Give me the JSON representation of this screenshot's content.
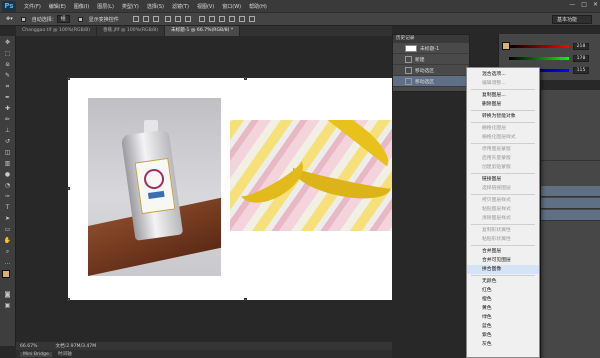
{
  "app": {
    "logo": "Ps"
  },
  "menubar": {
    "items": [
      "文件(F)",
      "编辑(E)",
      "图像(I)",
      "图层(L)",
      "类型(Y)",
      "选择(S)",
      "滤镜(T)",
      "视图(V)",
      "窗口(W)",
      "帮助(H)"
    ],
    "window_controls": [
      "—",
      "□",
      "✕"
    ]
  },
  "options": {
    "auto_select_label": "自动选择：",
    "auto_select_value": "组",
    "show_transform_label": "显示变换控件",
    "workspace": "基本功能"
  },
  "tabs": [
    {
      "label": "Changgao.tif @ 100%(RGB/8)",
      "active": false
    },
    {
      "label": "香蕉.jfif @ 100%(RGB/8)",
      "active": false
    },
    {
      "label": "未标题-1 @ 66.7%(RGB/8) *",
      "active": true
    }
  ],
  "history": {
    "title": "历史记录",
    "doc": "未标题-1",
    "rows": [
      "新建",
      "移动选区",
      "移动选区"
    ],
    "selected": 2
  },
  "colors": {
    "values": [
      "218",
      "178",
      "115"
    ],
    "fg": "#d9b273",
    "accent": "#5f6f85"
  },
  "status": {
    "zoom": "66.67%",
    "doc_info": "文档:2.97M/3.47M"
  },
  "minibridge": {
    "tabs": [
      "Mini Bridge",
      "时间轴"
    ]
  },
  "context_menu": {
    "items": [
      {
        "label": "混合选项...",
        "disabled": false
      },
      {
        "label": "编辑调整...",
        "disabled": true
      },
      {
        "sep": true
      },
      {
        "label": "复制图层...",
        "disabled": false
      },
      {
        "label": "删除图层",
        "disabled": false
      },
      {
        "sep": true
      },
      {
        "label": "转换为智能对象",
        "disabled": false
      },
      {
        "sep": true
      },
      {
        "label": "栅格化图层",
        "disabled": true
      },
      {
        "label": "栅格化图层样式",
        "disabled": true
      },
      {
        "sep": true
      },
      {
        "label": "停用图层蒙版",
        "disabled": true
      },
      {
        "label": "启用矢量蒙版",
        "disabled": true
      },
      {
        "label": "创建剪贴蒙版",
        "disabled": true
      },
      {
        "sep": true
      },
      {
        "label": "链接图层",
        "disabled": false
      },
      {
        "label": "选择链接图层",
        "disabled": true
      },
      {
        "sep": true
      },
      {
        "label": "拷贝图层样式",
        "disabled": true
      },
      {
        "label": "粘贴图层样式",
        "disabled": true
      },
      {
        "label": "清除图层样式",
        "disabled": true
      },
      {
        "sep": true
      },
      {
        "label": "复制形状属性",
        "disabled": true
      },
      {
        "label": "粘贴形状属性",
        "disabled": true
      },
      {
        "sep": true
      },
      {
        "label": "合并图层",
        "disabled": false
      },
      {
        "label": "合并可见图层",
        "disabled": false
      },
      {
        "label": "拼合图像",
        "disabled": false,
        "highlight": true
      },
      {
        "sep": true
      },
      {
        "label": "无颜色",
        "disabled": false
      },
      {
        "label": "红色",
        "disabled": false
      },
      {
        "label": "橙色",
        "disabled": false
      },
      {
        "label": "黄色",
        "disabled": false
      },
      {
        "label": "绿色",
        "disabled": false
      },
      {
        "label": "蓝色",
        "disabled": false
      },
      {
        "label": "紫色",
        "disabled": false
      },
      {
        "label": "灰色",
        "disabled": false
      }
    ]
  }
}
